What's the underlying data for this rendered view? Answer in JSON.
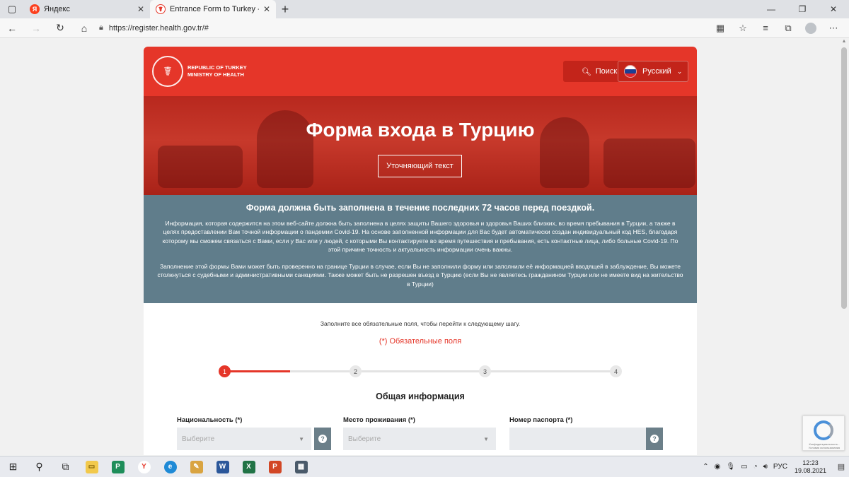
{
  "browser": {
    "tabs": [
      {
        "label": "Яндекс",
        "favicon": "Я",
        "active": false
      },
      {
        "label": "Entrance Form to Turkey - Sağlık",
        "favicon": "☤",
        "active": true
      }
    ],
    "url": "https://register.health.gov.tr/#",
    "icons": {
      "tab_actions": "tab-actions-icon",
      "back": "back-arrow-icon",
      "forward": "forward-arrow-icon",
      "refresh": "refresh-icon",
      "home": "home-icon",
      "lock": "lock-icon",
      "qr": "qr-icon",
      "favorite_add": "favorite-add-icon",
      "favorites": "favorites-icon",
      "collections": "collections-icon",
      "profile": "profile-icon",
      "menu": "menu-icon"
    }
  },
  "site": {
    "logo_line1": "REPUBLIC OF TURKEY",
    "logo_line2": "MINISTRY OF HEALTH",
    "search_label": "Поиск",
    "language_label": "Русский",
    "hero_title": "Форма входа в Турцию",
    "hero_button": "Уточняющий текст",
    "info_heading": "Форма должна быть заполнена в течение последних 72 часов перед поездкой.",
    "info_p1": "Информация, которая содержится на этом веб-сайте должна быть заполнена в целях защиты Вашего здоровья и здоровья Ваших близких, во время пребывания в Турции, а также в целях предоставлении Вам точной информации о пандемии Covid-19. На основе заполненной информации для Вас будет автоматически создан индивидуальный код HES, благодаря которому мы сможем связаться с Вами, если у Вас или у людей, с которыми Вы контактируете во время путешествия и пребывания, есть контактные лица, либо больные Covid-19. По этой причине точность и актуальность информации очень важны.",
    "info_p2": "Заполнение этой формы Вами может быть проверенно на границе Турции в случае, если Вы не заполнили форму или заполнили её информацией вводящей в заблуждение, Вы можете столкнуться с судебными и административными санкциями. Также может быть не разрешен въезд в Турцию (если Вы не являетесь гражданином Турции или не имеете вид на жительство в Турции)",
    "form_hint": "Заполните все обязательные поля, чтобы перейти к следующему шагу.",
    "required_note": "(*) Обязательные поля",
    "steps": [
      "1",
      "2",
      "3",
      "4"
    ],
    "active_step": 1,
    "section_title": "Общая информация",
    "fields": [
      {
        "label": "Национальность (*)",
        "placeholder": "Выберите"
      },
      {
        "label": "Место проживания (*)",
        "placeholder": "Выберите"
      },
      {
        "label": "Номер паспорта (*)",
        "placeholder": ""
      }
    ],
    "recaptcha_text": "Конфиденциальность - Условия использования",
    "colors": {
      "brand_red": "#e53629",
      "info_bg": "#607d8b"
    }
  },
  "taskbar": {
    "language": "РУС",
    "time": "12:23",
    "date": "19.08.2021"
  }
}
